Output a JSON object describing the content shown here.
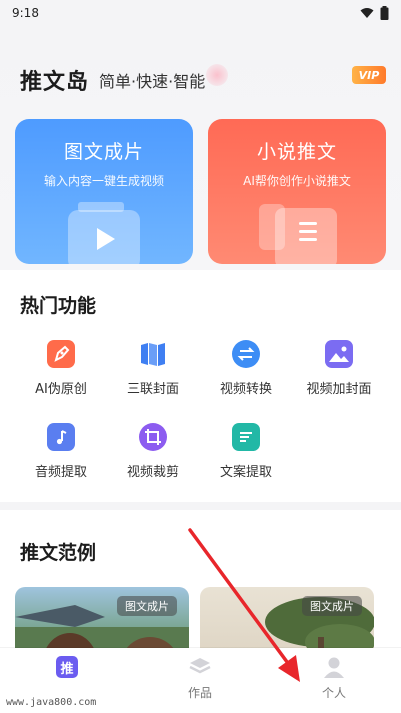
{
  "status": {
    "time": "9:18"
  },
  "header": {
    "app_name": "推文岛",
    "slogan": "简单·快速·智能",
    "vip": "VIP"
  },
  "cards": [
    {
      "title": "图文成片",
      "subtitle": "输入内容一键生成视频"
    },
    {
      "title": "小说推文",
      "subtitle": "AI帮你创作小说推文"
    }
  ],
  "hot": {
    "title": "热门功能",
    "items": [
      {
        "label": "AI伪原创"
      },
      {
        "label": "三联封面"
      },
      {
        "label": "视频转换"
      },
      {
        "label": "视频加封面"
      },
      {
        "label": "音频提取"
      },
      {
        "label": "视频裁剪"
      },
      {
        "label": "文案提取"
      }
    ]
  },
  "examples": {
    "title": "推文范例",
    "items": [
      {
        "tag": "图文成片"
      },
      {
        "tag": "图文成片"
      }
    ]
  },
  "tabbar": {
    "items": [
      {
        "label": "推"
      },
      {
        "label": "作品"
      },
      {
        "label": "个人"
      }
    ]
  },
  "watermark": "www.java800.com",
  "colors": {
    "blue_card": "#4e9bff",
    "red_card": "#ff6a55",
    "annotation_arrow": "#e8262b"
  }
}
